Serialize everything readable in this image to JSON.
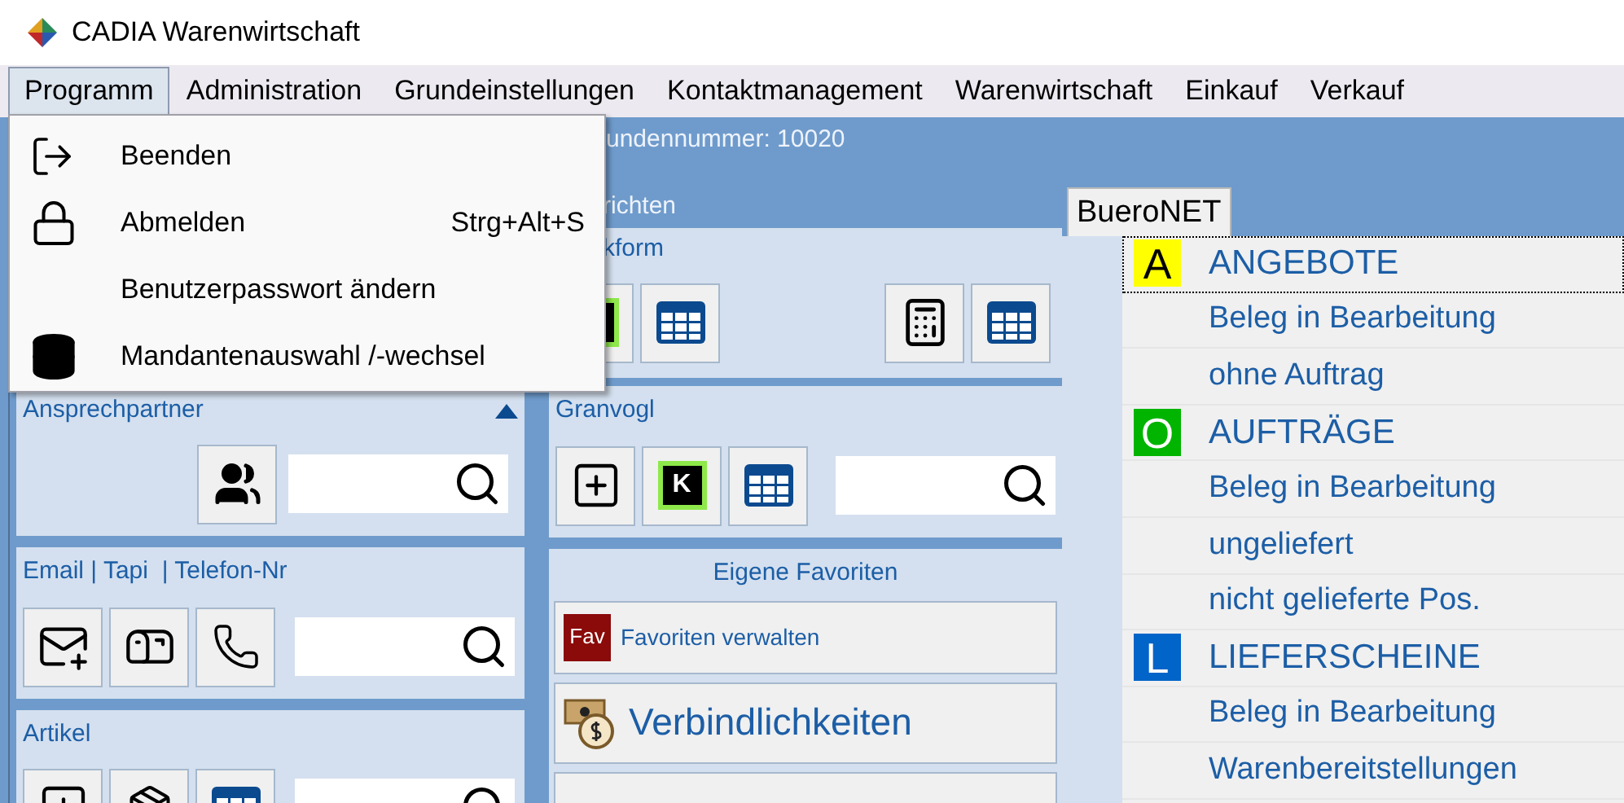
{
  "window": {
    "title": "CADIA Warenwirtschaft"
  },
  "menu_bar": [
    {
      "label": "Programm",
      "selected": true
    },
    {
      "label": "Administration",
      "selected": false
    },
    {
      "label": "Grundeinstellungen",
      "selected": false
    },
    {
      "label": "Kontaktmanagement",
      "selected": false
    },
    {
      "label": "Warenwirtschaft",
      "selected": false
    },
    {
      "label": "Einkauf",
      "selected": false
    },
    {
      "label": "Verkauf",
      "selected": false
    }
  ],
  "open_menu": {
    "items": [
      {
        "label": "Beenden"
      },
      {
        "label": "Abmelden",
        "shortcut": "Strg+Alt+S"
      },
      {
        "label": "Benutzerpasswort ändern"
      },
      {
        "label": "Mandantenauswahl /-wechsel"
      }
    ]
  },
  "customer_info": "undennummer: 10020",
  "group_label": "richten",
  "left_panels": [
    {
      "title": "Ansprechpartner"
    },
    {
      "title": "Email | Tapi  | Telefon-Nr"
    },
    {
      "title": "Artikel"
    }
  ],
  "middle_panels": {
    "quick_title": "kform",
    "granvogl": {
      "title": "Granvogl",
      "badge": "K"
    },
    "favorites": {
      "title": "Eigene Favoriten",
      "items": [
        {
          "badge": "Fav",
          "label": "Favoriten verwalten"
        },
        {
          "label": "Verbindlichkeiten"
        }
      ]
    }
  },
  "bueronet": {
    "tab": {
      "label": "BueroNET",
      "selected": true
    },
    "list": [
      {
        "kind": "heading",
        "badge": "A",
        "label": "ANGEBOTE",
        "color": "#ffff00",
        "selected": true
      },
      {
        "kind": "entry",
        "label": "Beleg in Bearbeitung",
        "selected": false
      },
      {
        "kind": "entry",
        "label": "ohne Auftrag",
        "selected": false
      },
      {
        "kind": "heading",
        "badge": "O",
        "label": "AUFTRÄGE",
        "color": "#00b400",
        "selected": false
      },
      {
        "kind": "entry",
        "label": "Beleg in Bearbeitung",
        "selected": false
      },
      {
        "kind": "entry",
        "label": "ungeliefert",
        "selected": false
      },
      {
        "kind": "entry",
        "label": "nicht gelieferte Pos.",
        "selected": false
      },
      {
        "kind": "heading",
        "badge": "L",
        "label": "LIEFERSCHEINE",
        "color": "#0064c8",
        "selected": false
      },
      {
        "kind": "entry",
        "label": "Beleg in Bearbeitung",
        "selected": false
      },
      {
        "kind": "entry",
        "label": "Warenbereitstellungen",
        "selected": false
      }
    ]
  }
}
